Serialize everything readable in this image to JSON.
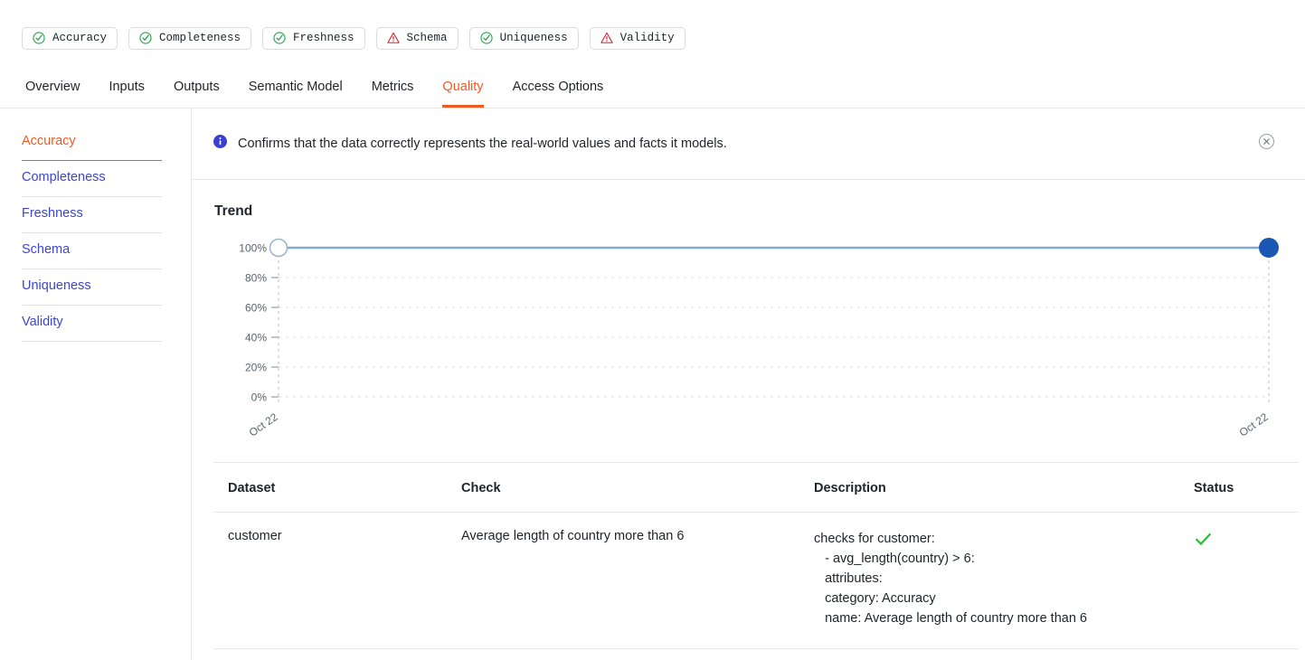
{
  "badges": [
    {
      "label": "Accuracy",
      "icon": "check-circle-icon",
      "state": "pass"
    },
    {
      "label": "Completeness",
      "icon": "check-circle-icon",
      "state": "pass"
    },
    {
      "label": "Freshness",
      "icon": "check-circle-icon",
      "state": "pass"
    },
    {
      "label": "Schema",
      "icon": "warning-triangle-icon",
      "state": "warn"
    },
    {
      "label": "Uniqueness",
      "icon": "check-circle-icon",
      "state": "pass"
    },
    {
      "label": "Validity",
      "icon": "warning-triangle-icon",
      "state": "warn"
    }
  ],
  "tabs": [
    {
      "label": "Overview",
      "active": false
    },
    {
      "label": "Inputs",
      "active": false
    },
    {
      "label": "Outputs",
      "active": false
    },
    {
      "label": "Semantic Model",
      "active": false
    },
    {
      "label": "Metrics",
      "active": false
    },
    {
      "label": "Quality",
      "active": true
    },
    {
      "label": "Access Options",
      "active": false
    }
  ],
  "sidebar": {
    "items": [
      {
        "label": "Accuracy",
        "active": true
      },
      {
        "label": "Completeness",
        "active": false
      },
      {
        "label": "Freshness",
        "active": false
      },
      {
        "label": "Schema",
        "active": false
      },
      {
        "label": "Uniqueness",
        "active": false
      },
      {
        "label": "Validity",
        "active": false
      }
    ]
  },
  "banner": {
    "icon": "info-circle-icon",
    "text": "Confirms that the data correctly represents the real-world values and facts it models.",
    "close_icon": "close-circle-icon"
  },
  "trend": {
    "title": "Trend"
  },
  "chart_data": {
    "type": "line",
    "title": "Trend",
    "xlabel": "",
    "ylabel": "",
    "x": [
      "Oct 22",
      "Oct 22"
    ],
    "tick_labels_x": [
      "Oct 22",
      "Oct 22"
    ],
    "tick_labels_y": [
      "0%",
      "20%",
      "40%",
      "60%",
      "80%",
      "100%"
    ],
    "values": [
      100,
      100
    ],
    "ylim": [
      0,
      100
    ],
    "yticks": [
      0,
      20,
      40,
      60,
      80,
      100
    ],
    "grid": true,
    "grid_style": "dashed",
    "legend": "none",
    "line_color": "#7fa8cc",
    "marker_start_color": "#ffffff",
    "marker_end_color": "#1a56b4",
    "series": [
      {
        "name": "Accuracy",
        "values": [
          100,
          100
        ]
      }
    ]
  },
  "table": {
    "columns": [
      "Dataset",
      "Check",
      "Description",
      "Status"
    ],
    "rows": [
      {
        "dataset": "customer",
        "check": "Average length of country more than 6",
        "description": "checks for customer:\n   - avg_length(country) > 6:\n   attributes:\n   category: Accuracy\n   name: Average length of country more than 6",
        "status": "pass",
        "status_icon": "green-check-icon"
      }
    ]
  },
  "colors": {
    "accent": "#f15a22",
    "link": "#3b46d1",
    "pass": "#2da44e",
    "warn": "#d1242f",
    "status_pass": "#22c32e",
    "info": "#3b3fd1",
    "line": "#7fa8cc",
    "marker": "#1a56b4"
  }
}
